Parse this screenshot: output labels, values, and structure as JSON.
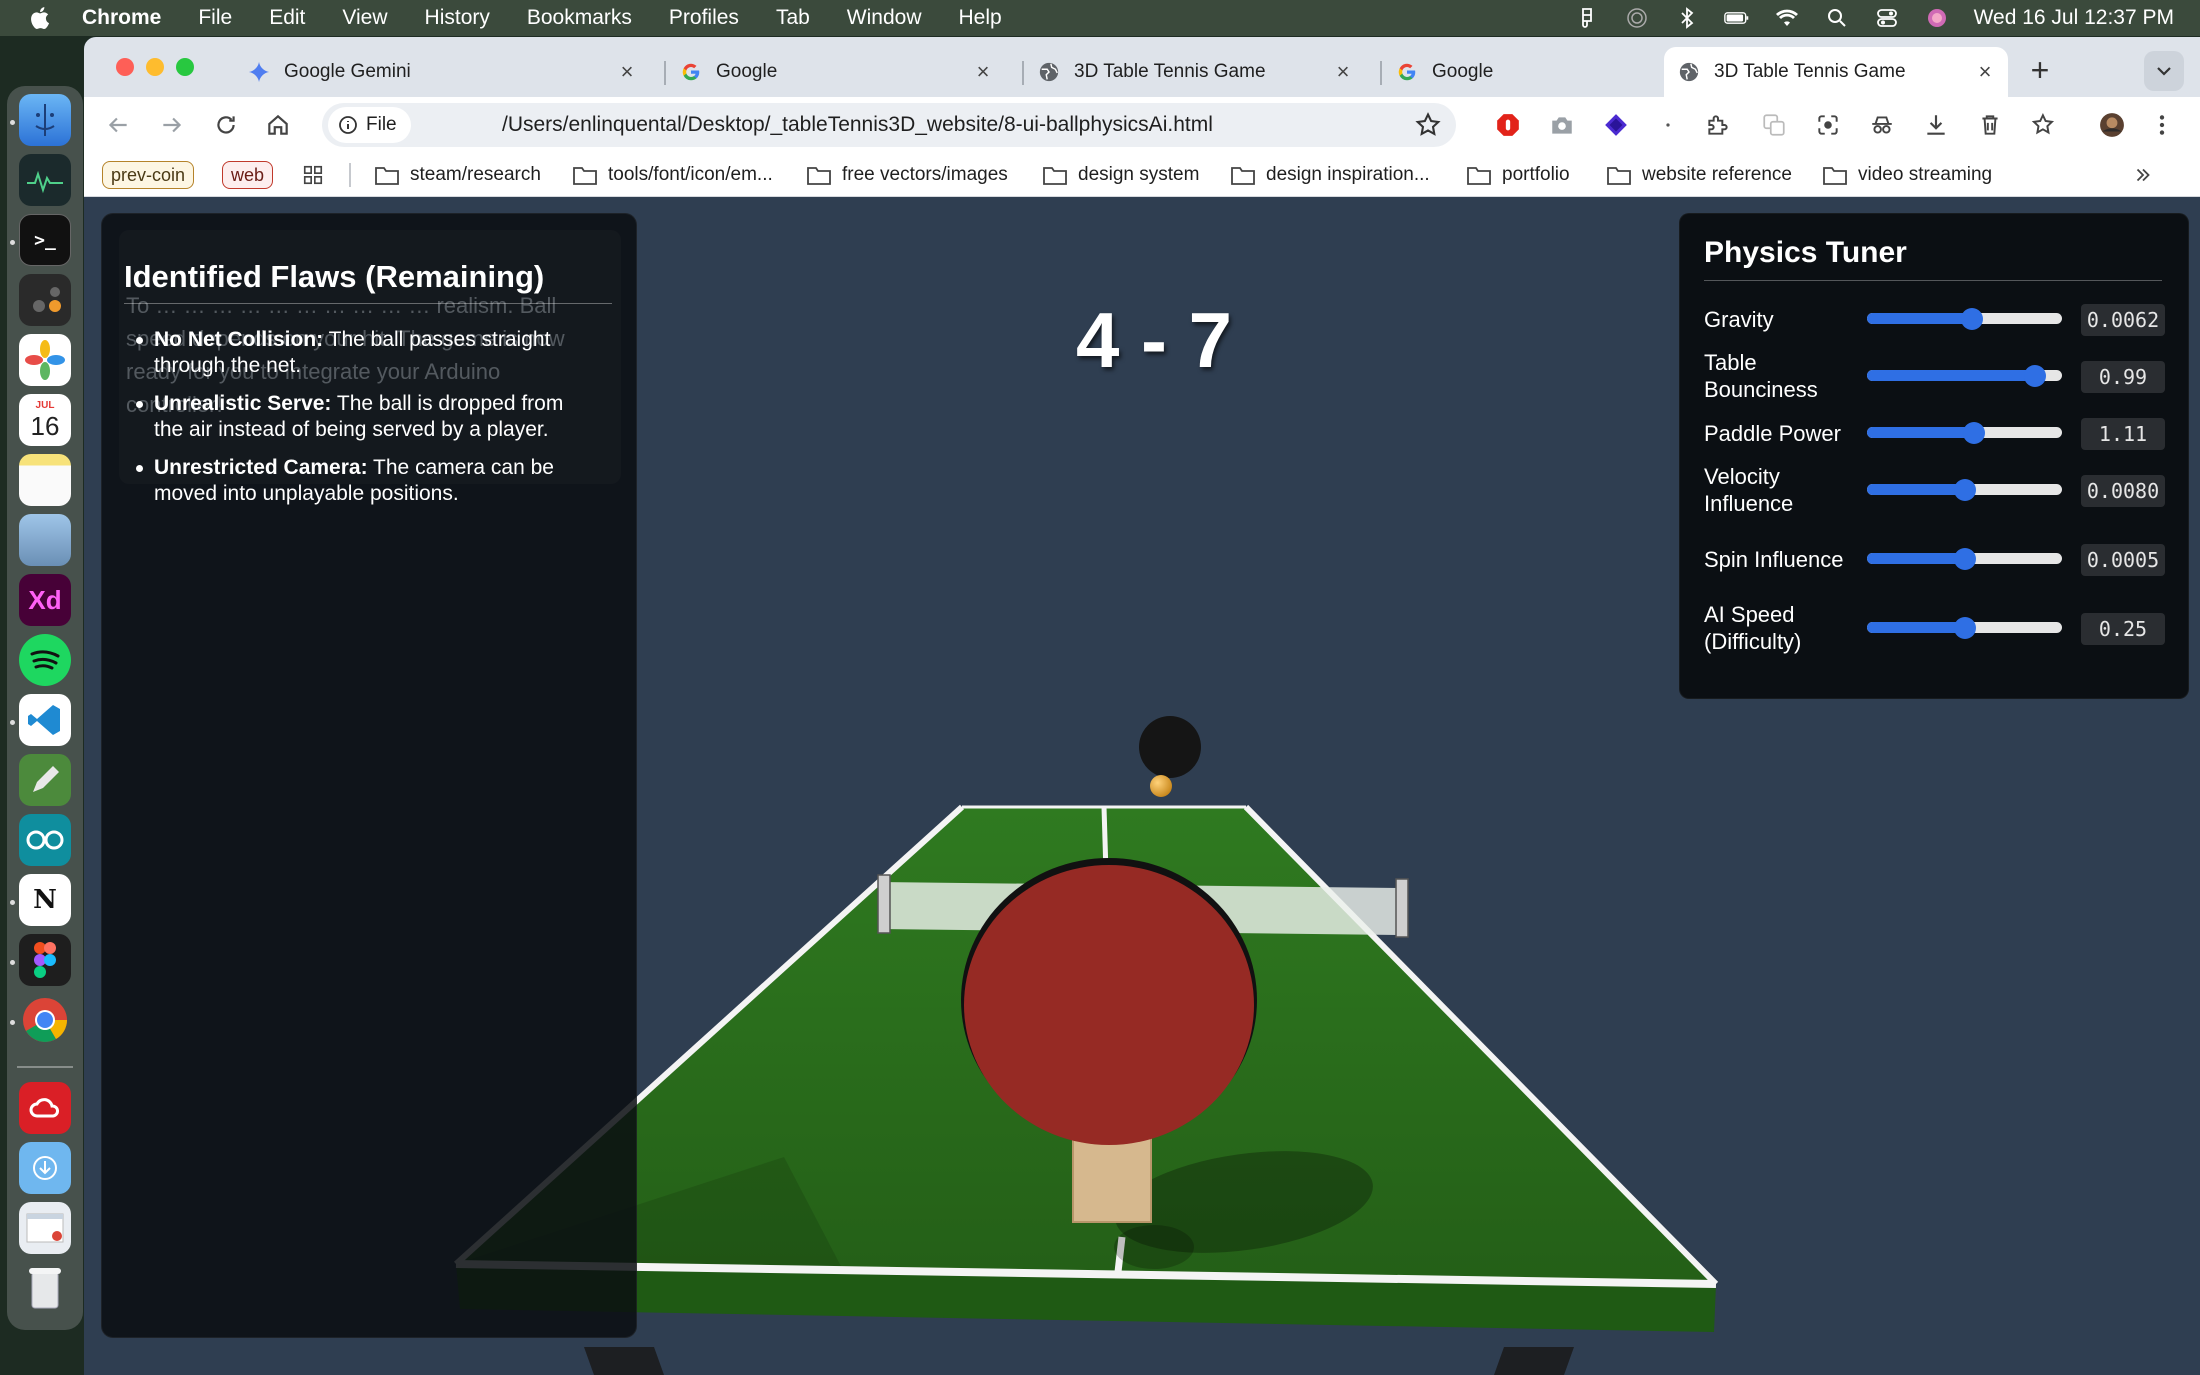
{
  "menubar": {
    "app_name": "Chrome",
    "menus": [
      "File",
      "Edit",
      "View",
      "History",
      "Bookmarks",
      "Profiles",
      "Tab",
      "Window",
      "Help"
    ],
    "clock": "Wed 16 Jul  12:37 PM"
  },
  "dock": {
    "calendar_month": "JUL",
    "calendar_day": "16",
    "xd_label": "Xd"
  },
  "tabs": [
    {
      "title": "Google Gemini",
      "icon": "gemini-icon",
      "active": false
    },
    {
      "title": "Google",
      "icon": "google-icon",
      "active": false
    },
    {
      "title": "3D Table Tennis Game",
      "icon": "globe-icon",
      "active": false
    },
    {
      "title": "Google",
      "icon": "google-icon",
      "active": false
    },
    {
      "title": "3D Table Tennis Game",
      "icon": "globe-icon",
      "active": true
    }
  ],
  "omnibox": {
    "chip_label": "File",
    "url": "/Users/enlinquental/Desktop/_tableTennis3D_website/8-ui-ballphysicsAi.html"
  },
  "bookmarks": {
    "pills": [
      {
        "label": "prev-coin",
        "color": "#b5832a"
      },
      {
        "label": "web",
        "color": "#c0392b"
      }
    ],
    "folders": [
      "steam/research",
      "tools/font/icon/em...",
      "free vectors/images",
      "design system",
      "design inspiration...",
      "portfolio",
      "website reference",
      "video streaming"
    ]
  },
  "game": {
    "score": "4 - 7",
    "ghost_text": "To … … … … … … … … … … realism. Ball speed depends on your hit. The game is now ready for you to integrate your Arduino controller!",
    "flaws_title": "Identified Flaws (Remaining)",
    "flaws": [
      {
        "title": "No Net Collision:",
        "text": " The ball passes straight through the net."
      },
      {
        "title": "Unrealistic Serve:",
        "text": " The ball is dropped from the air instead of being served by a player."
      },
      {
        "title": "Unrestricted Camera:",
        "text": " The camera can be moved into unplayable positions."
      }
    ],
    "colors": {
      "table": "#2e6b1f",
      "paddle": "#962a24",
      "handle": "#d6b88e",
      "ball": "#e0a52c",
      "slider_accent": "#2f6fe4"
    }
  },
  "tuner": {
    "title": "Physics Tuner",
    "params": [
      {
        "label": "Gravity",
        "value": "0.0062",
        "level": 0.54
      },
      {
        "label": "Table Bounciness",
        "value": "0.99",
        "level": 0.86
      },
      {
        "label": "Paddle Power",
        "value": "1.11",
        "level": 0.55
      },
      {
        "label": "Velocity Influence",
        "value": "0.0080",
        "level": 0.5
      },
      {
        "label": "Spin Influence",
        "value": "0.0005",
        "level": 0.5
      },
      {
        "label": "AI Speed (Difficulty)",
        "value": "0.25",
        "level": 0.5
      }
    ]
  }
}
